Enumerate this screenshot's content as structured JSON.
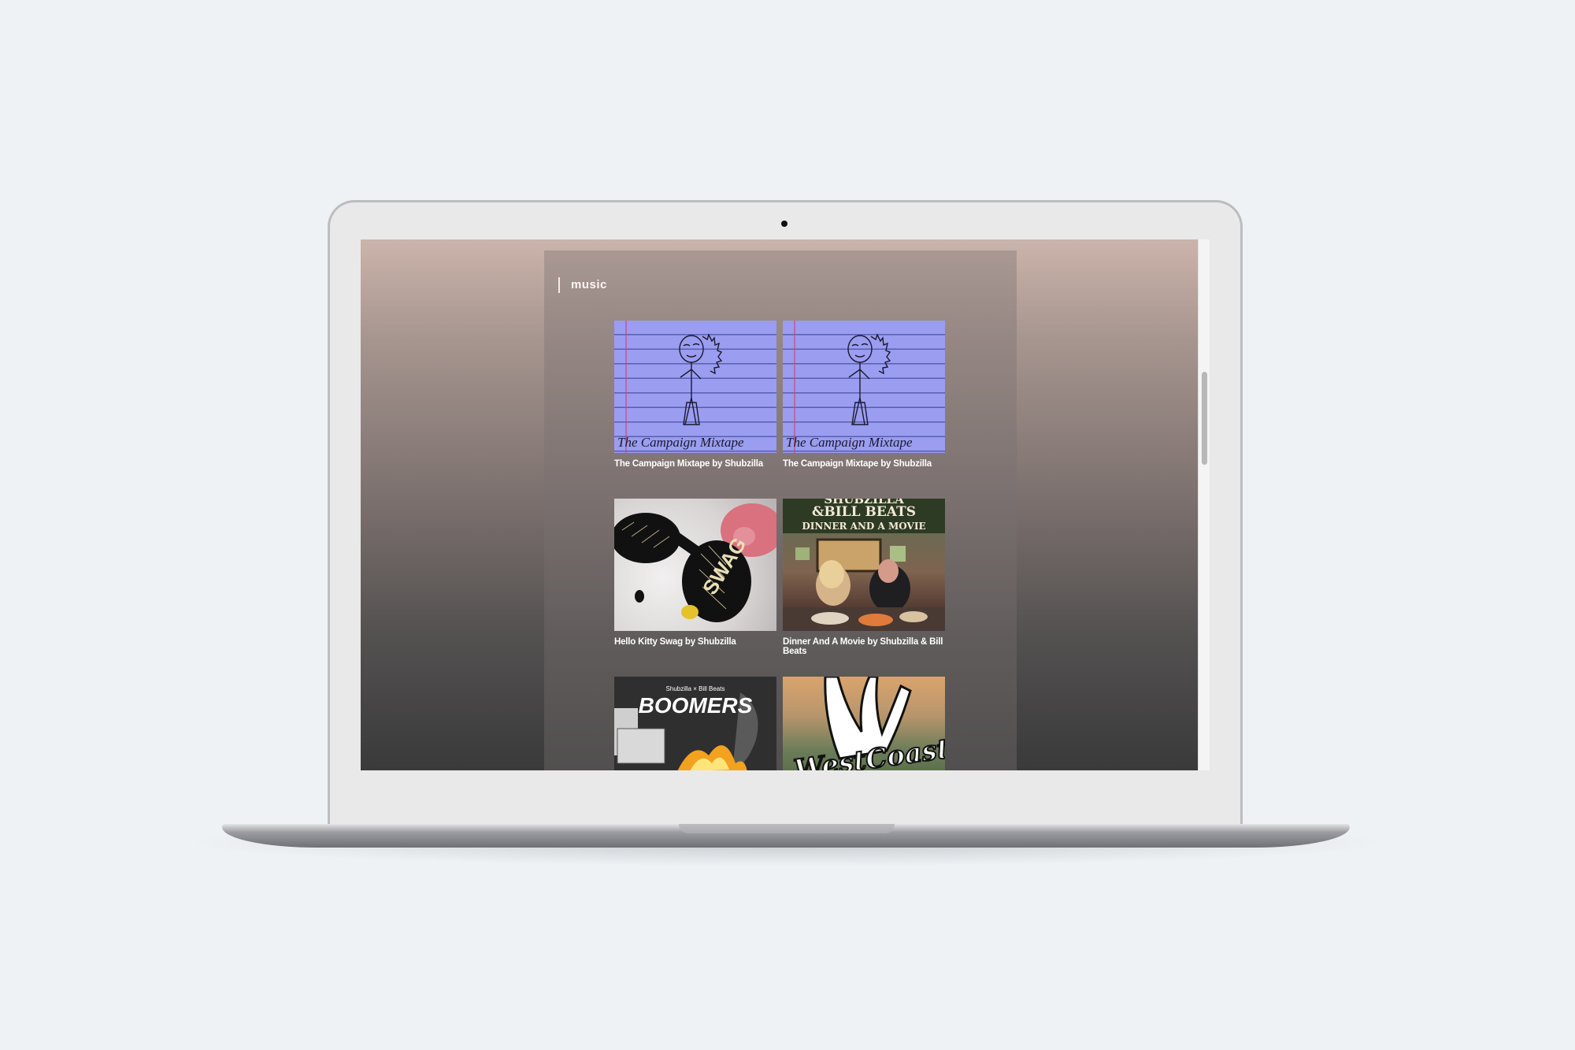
{
  "page": {
    "section_title": "music"
  },
  "cards": [
    {
      "title": "The Campaign Mixtape by Shubzilla",
      "art_text": "The Campaign Mixtape"
    },
    {
      "title": "The Campaign Mixtape by Shubzilla",
      "art_text": "The Campaign Mixtape"
    },
    {
      "title": "Hello Kitty Swag by Shubzilla",
      "art_text": "SWAG"
    },
    {
      "title": "Dinner And A Movie by Shubzilla & Bill Beats",
      "art_line1": "SHUBZILLA",
      "art_line2": "&BILL BEATS",
      "art_line3": "DINNER AND A MOVIE"
    },
    {
      "title": "",
      "art_small": "Shubzilla × Bill Beats",
      "art_text": "BOOMERS"
    },
    {
      "title": "",
      "art_text": "WestCoast"
    }
  ],
  "colors": {
    "page_background": "#eef2f5",
    "title_text": "#ffffff",
    "gradient_top": "#cbb4ab",
    "gradient_bottom": "#3a3a3b"
  }
}
